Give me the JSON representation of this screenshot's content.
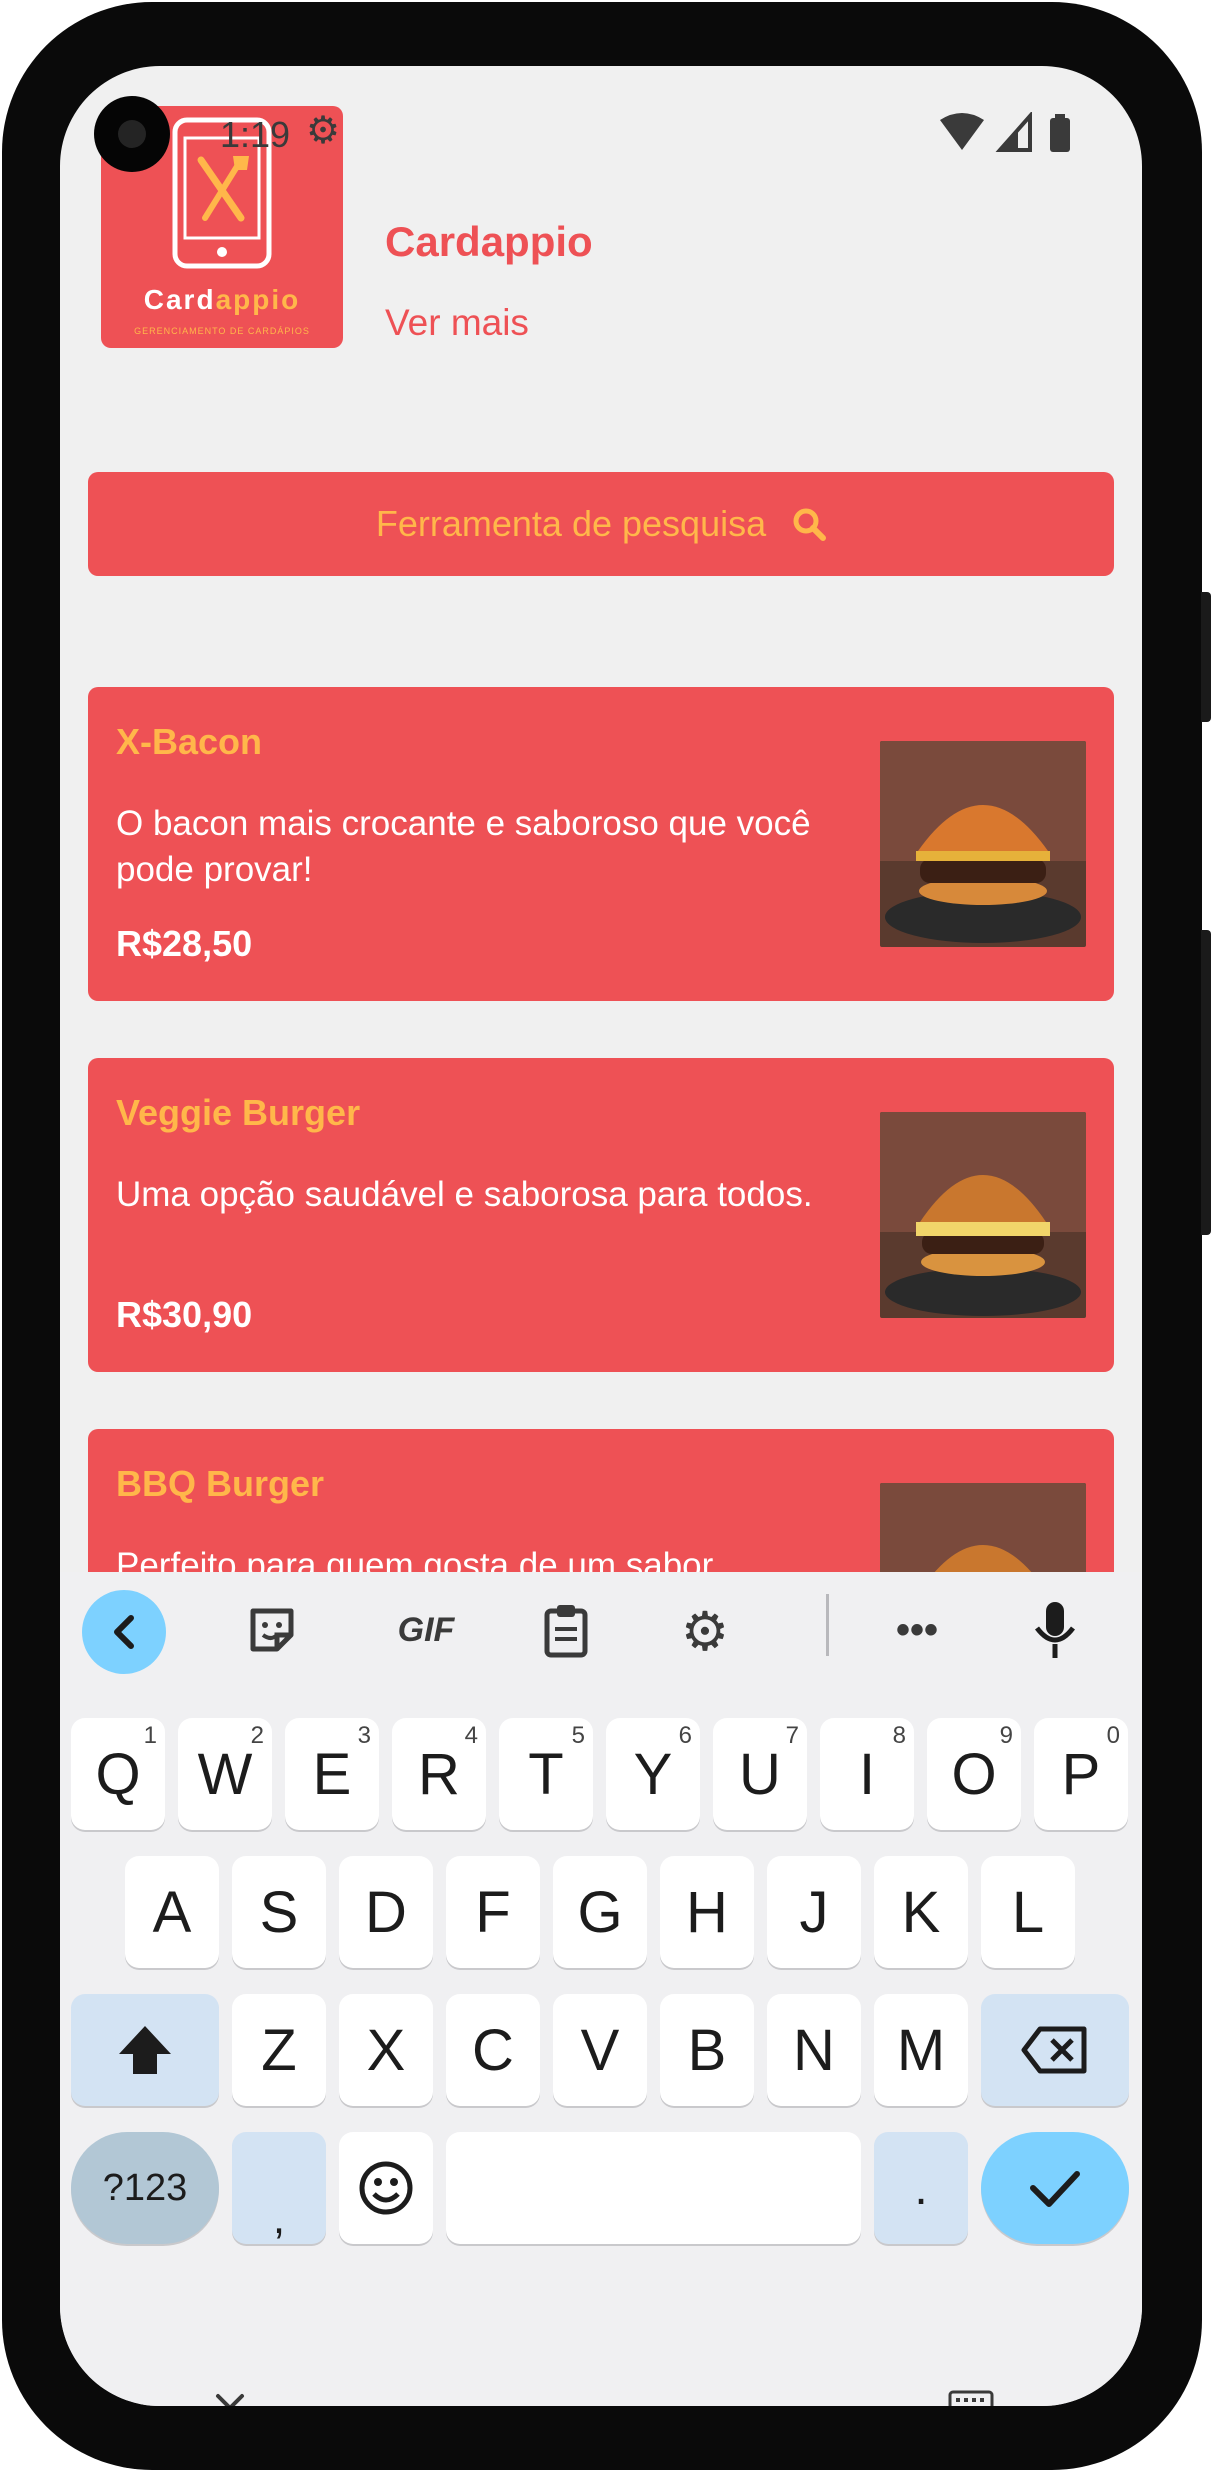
{
  "status_bar": {
    "time": "1:19"
  },
  "header": {
    "logo_text_a": "Card",
    "logo_text_b": "appio",
    "logo_subtitle": "GERENCIAMENTO DE CARDÁPIOS",
    "brand_name": "Cardappio",
    "see_more": "Ver mais"
  },
  "search": {
    "label": "Ferramenta de pesquisa",
    "icon": "search-icon"
  },
  "menu_items": [
    {
      "title": "X-Bacon",
      "description": "O bacon mais crocante e saboroso que você pode provar!",
      "price": "R$28,50"
    },
    {
      "title": "Veggie Burger",
      "description": "Uma opção saudável e saborosa para todos.",
      "price": "R$30,90"
    },
    {
      "title": "BBQ Burger",
      "description": "Perfeito para quem gosta de um sabor",
      "price": ""
    }
  ],
  "keyboard": {
    "toolbar": [
      "back-chevron-icon",
      "sticker-icon",
      "gif",
      "clipboard-icon",
      "gear-icon",
      "more-icon",
      "microphone-icon"
    ],
    "gif_label": "GIF",
    "row1": [
      "Q",
      "W",
      "E",
      "R",
      "T",
      "Y",
      "U",
      "I",
      "O",
      "P"
    ],
    "row1_hints": [
      "1",
      "2",
      "3",
      "4",
      "5",
      "6",
      "7",
      "8",
      "9",
      "0"
    ],
    "row2": [
      "A",
      "S",
      "D",
      "F",
      "G",
      "H",
      "J",
      "K",
      "L"
    ],
    "row3": [
      "Z",
      "X",
      "C",
      "V",
      "B",
      "N",
      "M"
    ],
    "symbols_label": "?123",
    "comma_label": ",",
    "period_label": "."
  },
  "colors": {
    "accent": "#ee5155",
    "title_orange": "#ffb74a",
    "key_blue": "#7dd1ff"
  }
}
